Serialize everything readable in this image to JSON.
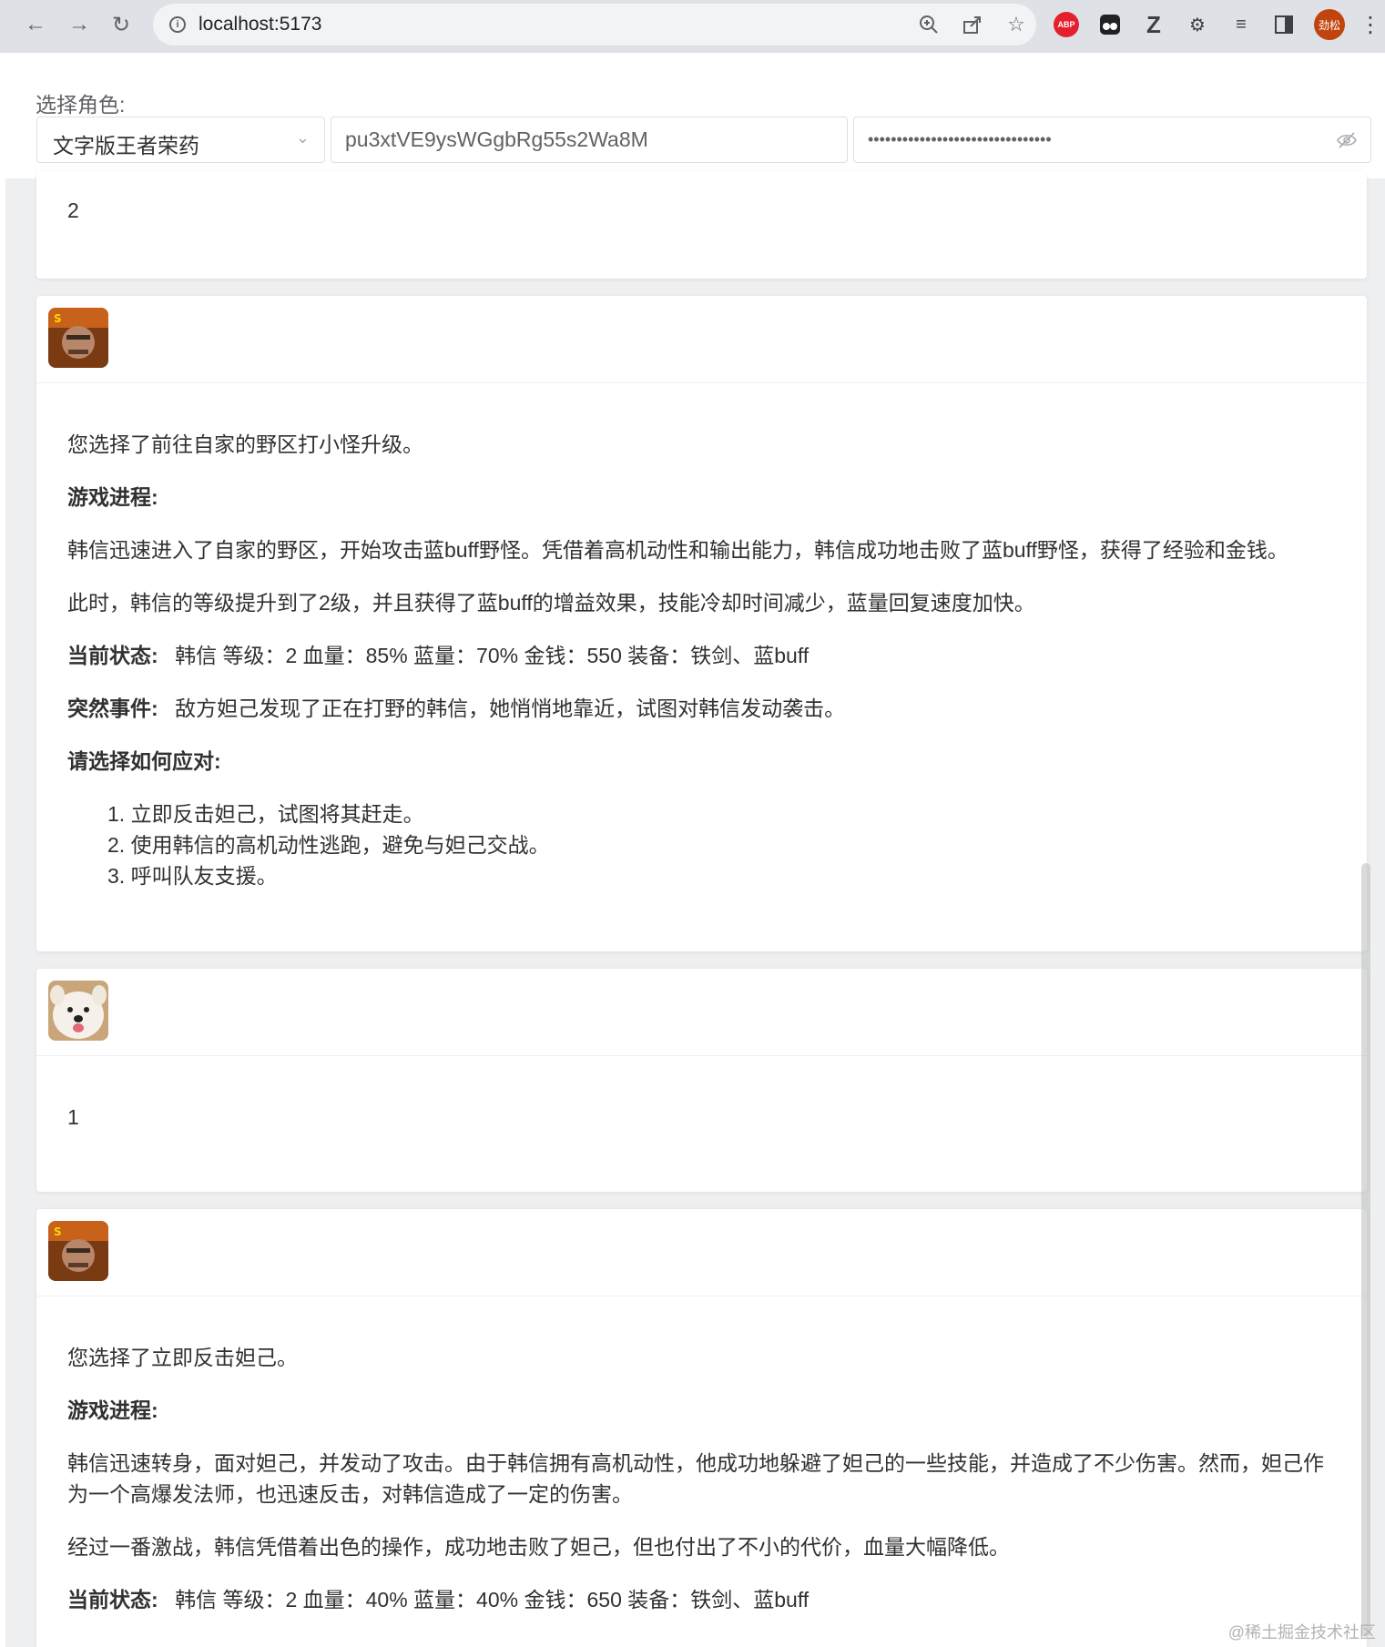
{
  "browser": {
    "url": "localhost:5173",
    "profile_initials": "劲松",
    "abp_label": "ABP"
  },
  "controls": {
    "role_label": "选择角色:",
    "role_selected": "文字版王者荣药",
    "api_key_value": "pu3xtVE9ysWGgbRg55s2Wa8M",
    "secret_masked": "••••••••••••••••••••••••••••••••"
  },
  "messages": [
    {
      "role": "user",
      "text": "2"
    },
    {
      "role": "assistant",
      "intro": "您选择了前往自家的野区打小怪升级。",
      "progress_heading": "游戏进程:",
      "progress": [
        "韩信迅速进入了自家的野区，开始攻击蓝buff野怪。凭借着高机动性和输出能力，韩信成功地击败了蓝buff野怪，获得了经验和金钱。",
        "此时，韩信的等级提升到了2级，并且获得了蓝buff的增益效果，技能冷却时间减少，蓝量回复速度加快。"
      ],
      "status_label": "当前状态:",
      "status_text": "韩信 等级：2 血量：85% 蓝量：70% 金钱：550 装备：铁剑、蓝buff",
      "event_label": "突然事件:",
      "event_text": "敌方妲己发现了正在打野的韩信，她悄悄地靠近，试图对韩信发动袭击。",
      "choose_heading": "请选择如何应对:",
      "options": [
        "1. 立即反击妲己，试图将其赶走。",
        "2. 使用韩信的高机动性逃跑，避免与妲己交战。",
        "3. 呼叫队友支援。"
      ]
    },
    {
      "role": "user",
      "text": "1"
    },
    {
      "role": "assistant",
      "intro": "您选择了立即反击妲己。",
      "progress_heading": "游戏进程:",
      "progress": [
        "韩信迅速转身，面对妲己，并发动了攻击。由于韩信拥有高机动性，他成功地躲避了妲己的一些技能，并造成了不少伤害。然而，妲己作为一个高爆发法师，也迅速反击，对韩信造成了一定的伤害。",
        "经过一番激战，韩信凭借着出色的操作，成功地击败了妲己，但也付出了不小的代价，血量大幅降低。"
      ],
      "status_label": "当前状态:",
      "status_text": "韩信 等级：2 血量：40% 蓝量：40% 金钱：650 装备：铁剑、蓝buff"
    }
  ],
  "watermark": "@稀土掘金技术社区"
}
